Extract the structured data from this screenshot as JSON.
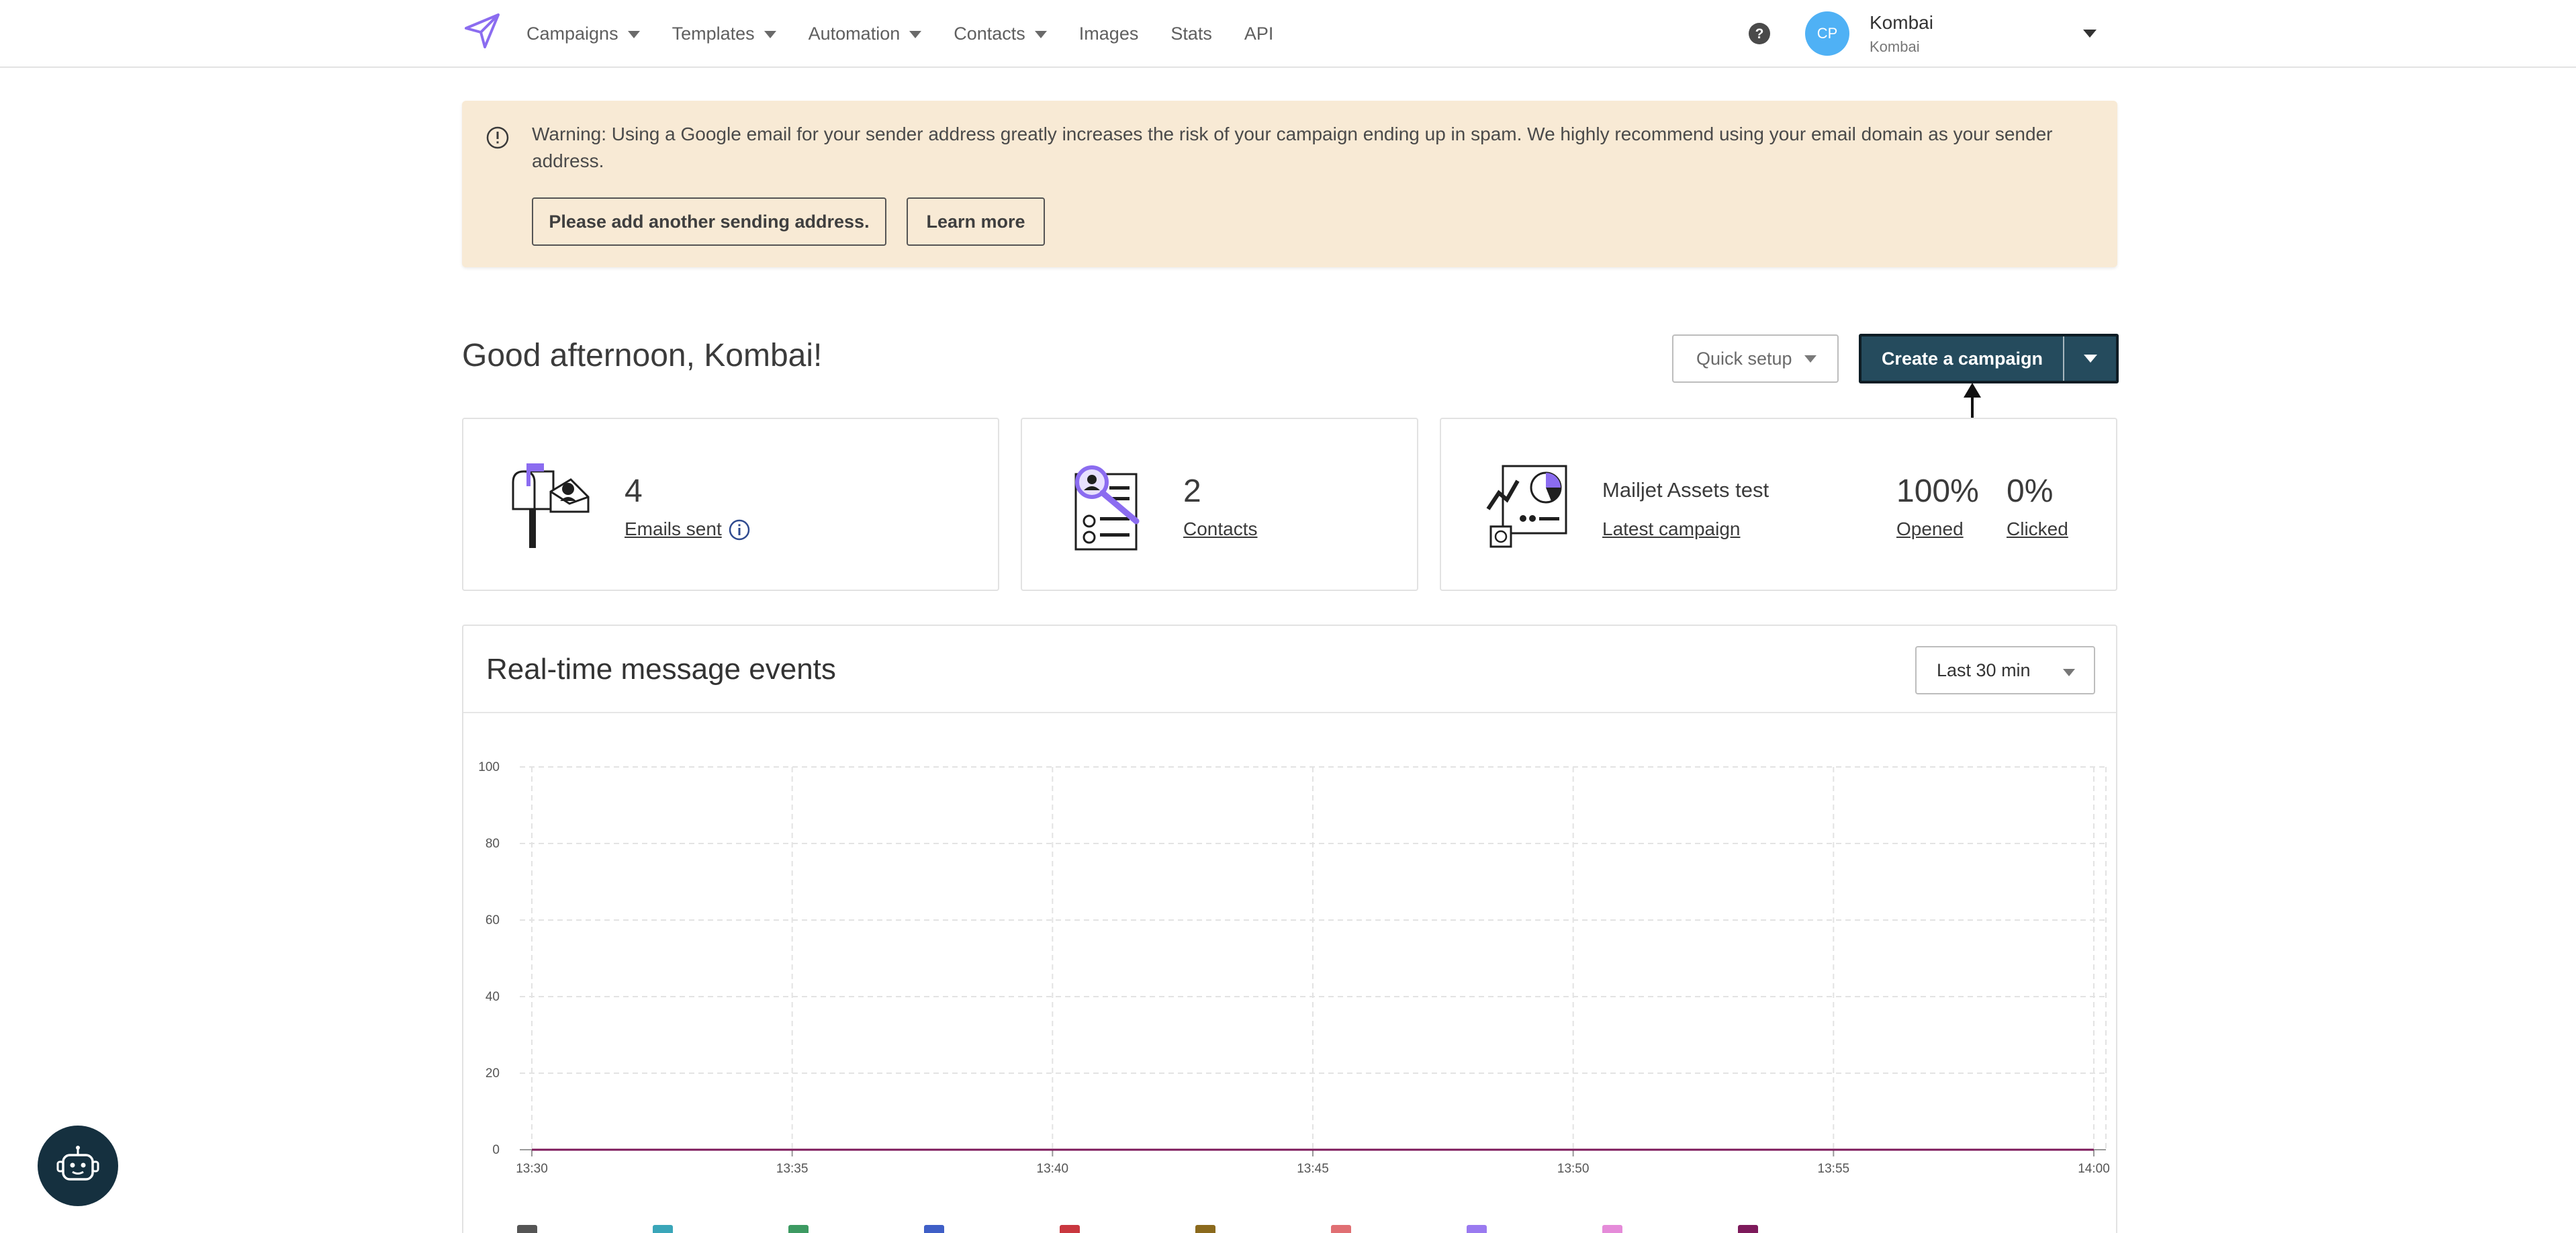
{
  "nav": {
    "items": [
      {
        "label": "Campaigns",
        "has_caret": true
      },
      {
        "label": "Templates",
        "has_caret": true
      },
      {
        "label": "Automation",
        "has_caret": true
      },
      {
        "label": "Contacts",
        "has_caret": true
      },
      {
        "label": "Images",
        "has_caret": false
      },
      {
        "label": "Stats",
        "has_caret": false
      },
      {
        "label": "API",
        "has_caret": false
      }
    ],
    "avatar_initials": "CP",
    "account_name": "Kombai",
    "account_sub": "Kombai",
    "icons": [
      "paper-plane-logo-icon",
      "help-icon",
      "chevron-down-icon"
    ]
  },
  "banner": {
    "text": "Warning: Using a Google email for your sender address greatly increases the risk of your campaign ending up in spam. We highly recommend using your email domain as your sender address.",
    "add_button": "Please add another sending address.",
    "learn_button": "Learn more",
    "icon": "exclamation-circle-icon"
  },
  "greeting": "Good afternoon, Kombai!",
  "actions": {
    "quick_setup": "Quick setup",
    "create_campaign": "Create a campaign"
  },
  "stats": {
    "emails_sent": {
      "value": "4",
      "label": "Emails sent"
    },
    "contacts": {
      "value": "2",
      "label": "Contacts"
    },
    "latest": {
      "campaign_name": "Mailjet Assets test",
      "label": "Latest campaign",
      "opened_value": "100%",
      "opened_label": "Opened",
      "clicked_value": "0%",
      "clicked_label": "Clicked"
    }
  },
  "realtime": {
    "title": "Real-time message events",
    "range_select": "Last 30 min"
  },
  "chart_data": {
    "type": "line",
    "title": "",
    "xlabel": "",
    "ylabel": "",
    "x": [
      "13:30",
      "13:35",
      "13:40",
      "13:45",
      "13:50",
      "13:55",
      "14:00"
    ],
    "y_ticks": [
      0,
      20,
      40,
      60,
      80,
      100
    ],
    "ylim": [
      0,
      100
    ],
    "grid": true,
    "series": [
      {
        "color": "#7d1a5b",
        "values": [
          0,
          0,
          0,
          0,
          0,
          0,
          0
        ]
      }
    ],
    "legend_colors": [
      "#555555",
      "#3aa6b9",
      "#3d9a62",
      "#3f5fc7",
      "#c9373f",
      "#8b6a1d",
      "#e06f73",
      "#9a7af0",
      "#e58bd9",
      "#7d1a5b"
    ]
  },
  "colors": {
    "brand": "#8b6cf0",
    "primary_button": "#254b5d",
    "banner_bg": "#f8ead5",
    "avatar": "#4fb1f5"
  }
}
